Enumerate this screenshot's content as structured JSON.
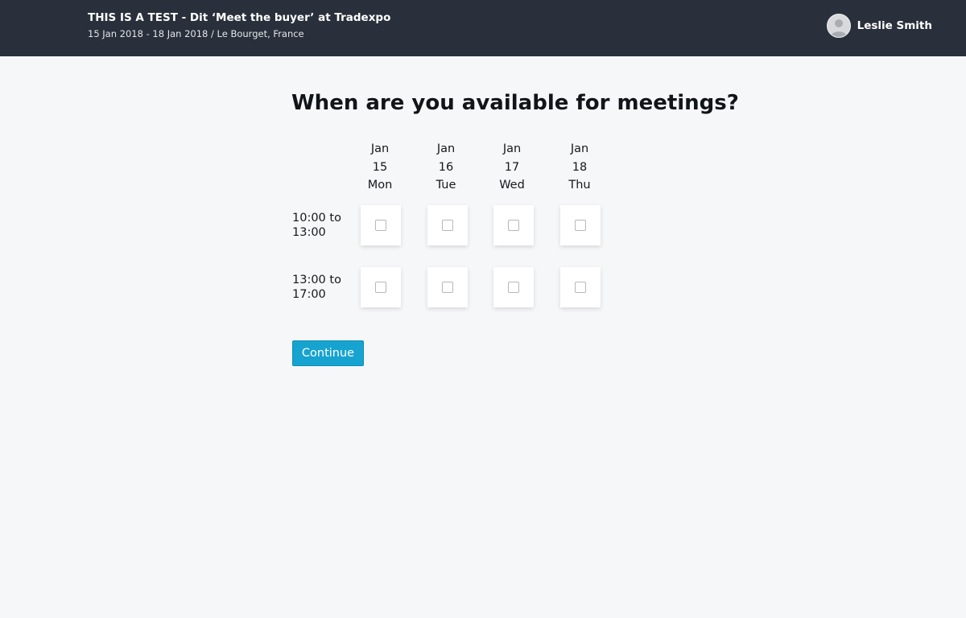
{
  "header": {
    "event_title": "THIS IS A TEST - Dit ‘Meet the buyer’ at Tradexpo",
    "event_subtitle": "15 Jan 2018 - 18 Jan 2018 / Le Bourget, France",
    "user_name": "Leslie Smith",
    "avatar_icon": "user-avatar-icon",
    "background_color": "#29303b"
  },
  "main": {
    "title": "When are you available for meetings?",
    "days": [
      {
        "month": "Jan",
        "day": "15",
        "weekday": "Mon"
      },
      {
        "month": "Jan",
        "day": "16",
        "weekday": "Tue"
      },
      {
        "month": "Jan",
        "day": "17",
        "weekday": "Wed"
      },
      {
        "month": "Jan",
        "day": "18",
        "weekday": "Thu"
      }
    ],
    "slots": [
      {
        "label": "10:00 to 13:00",
        "checked": [
          false,
          false,
          false,
          false
        ]
      },
      {
        "label": "13:00 to 17:00",
        "checked": [
          false,
          false,
          false,
          false
        ]
      }
    ],
    "continue_label": "Continue",
    "accent_color": "#17a3cf"
  }
}
